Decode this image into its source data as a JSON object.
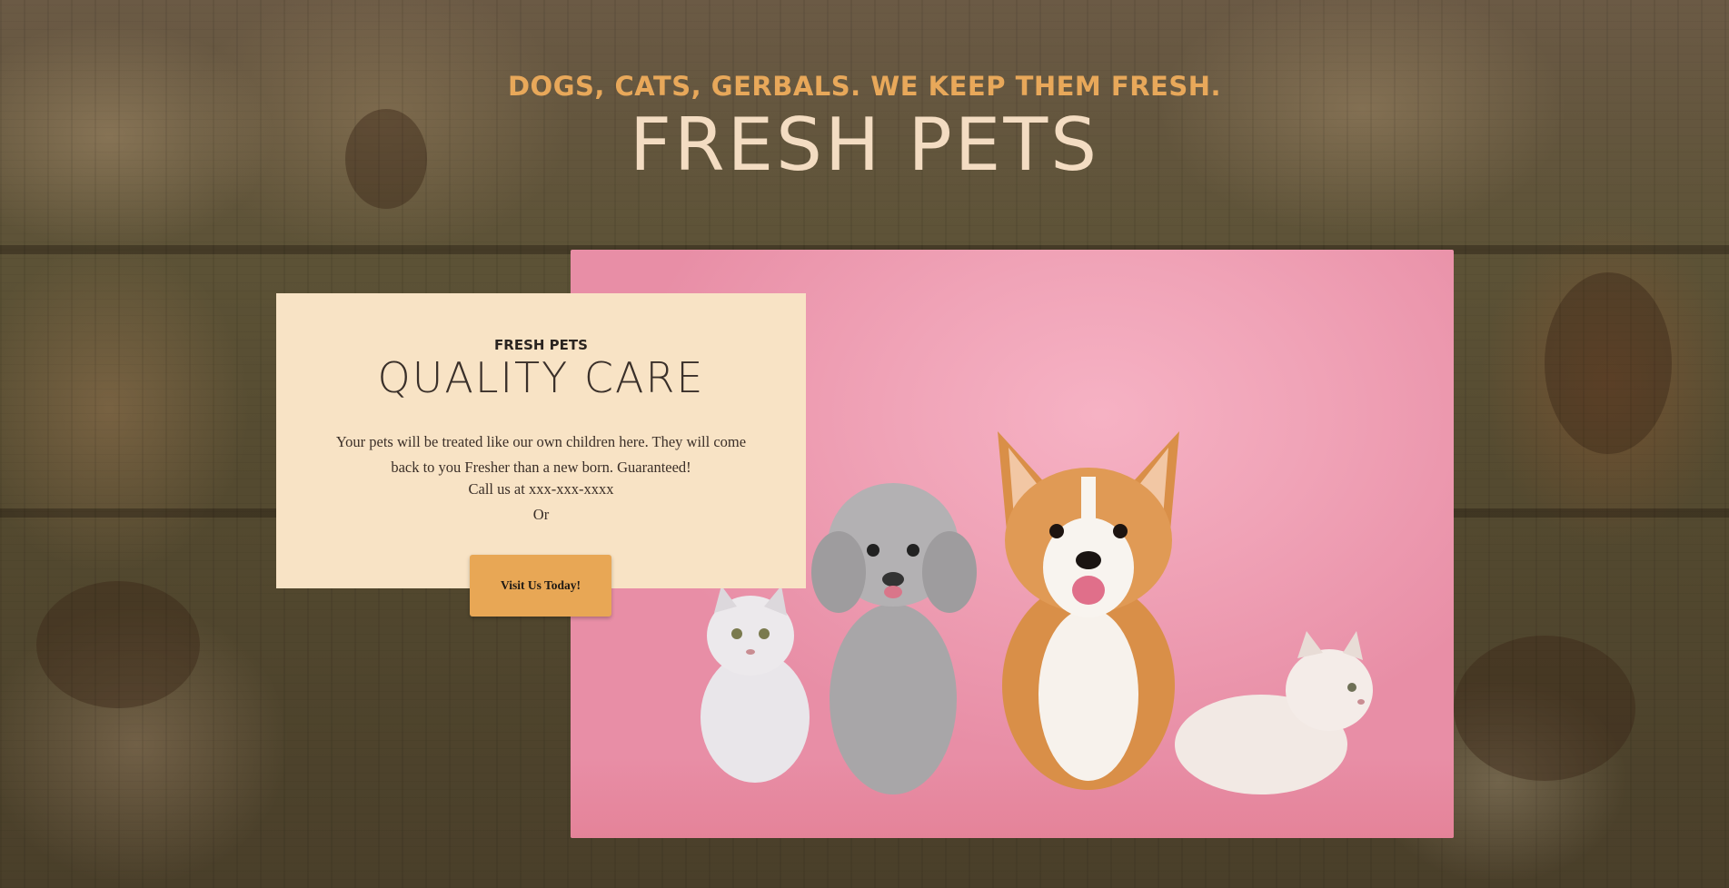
{
  "hero": {
    "subtitle": "DOGS, CATS, GERBALS. WE KEEP THEM FRESH.",
    "title": "FRESH PETS"
  },
  "card": {
    "kicker": "FRESH PETS",
    "heading": "QUALITY CARE",
    "body": "Your pets will be treated like our own children here. They will come back to you Fresher than a new born. Guaranteed!",
    "call": "Call us at xxx-xxx-xxxx",
    "or": "Or"
  },
  "cta": {
    "label": "Visit Us Today!"
  },
  "colors": {
    "accent": "#e8a755",
    "card_bg": "#f8e3c5",
    "photo_bg": "#f0a3b7"
  }
}
